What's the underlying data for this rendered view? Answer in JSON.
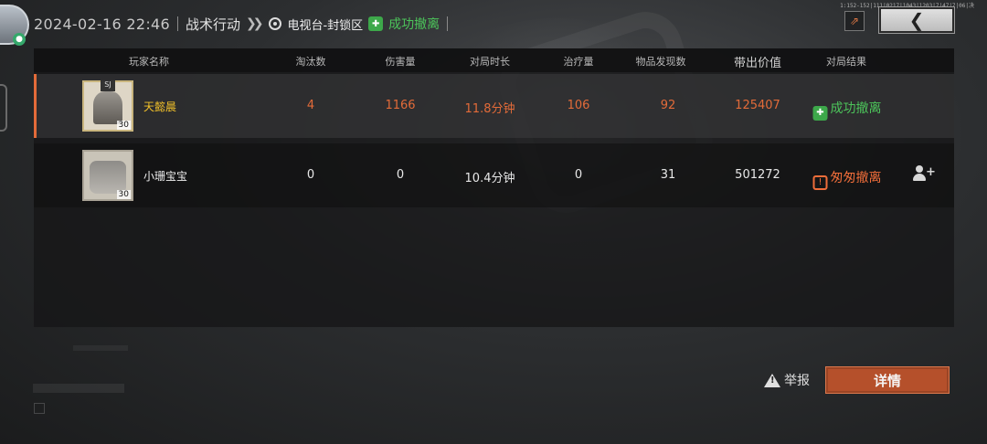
{
  "header": {
    "datetime": "2024-02-16 22:46",
    "mode": "战术行动",
    "map": "电视台-封锁区",
    "result": "成功撤离",
    "build_info": "1:152-152|111|0217|1043|1203|7|47|7|06|决"
  },
  "columns": {
    "player": "玩家名称",
    "kills": "淘汰数",
    "damage": "伤害量",
    "duration": "对局时长",
    "healing": "治疗量",
    "items_found": "物品发现数",
    "value": "带出价值",
    "result": "对局结果"
  },
  "rows": [
    {
      "name": "天懿晨",
      "level": "30",
      "kills": "4",
      "damage": "1166",
      "duration": "11.8分钟",
      "healing": "106",
      "items_found": "92",
      "value": "125407",
      "result": "成功撤离"
    },
    {
      "name": "小珊宝宝",
      "level": "30",
      "kills": "0",
      "damage": "0",
      "duration": "10.4分钟",
      "healing": "0",
      "items_found": "31",
      "value": "501272",
      "result": "匆匆撤离"
    }
  ],
  "actions": {
    "report": "举报",
    "detail": "详情"
  },
  "colors": {
    "accent_orange": "#e36b39",
    "success_green": "#4cc35a",
    "highlight_name": "#f1c02a"
  }
}
